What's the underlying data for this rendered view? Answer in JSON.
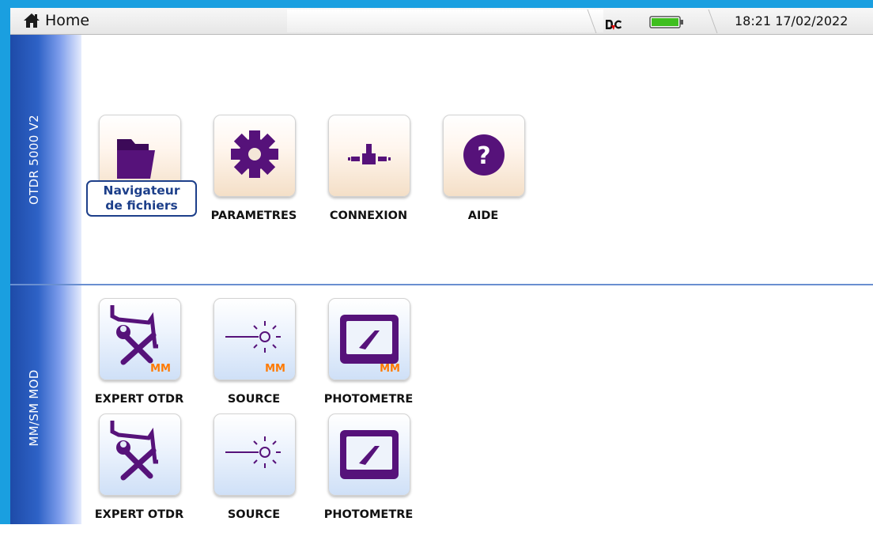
{
  "titlebar": {
    "title": "Home",
    "datetime": "18:21 17/02/2022",
    "battery_level": 1.0
  },
  "groups": [
    {
      "label": "OTDR 5000 V2",
      "tiles": [
        {
          "label": "Navigateur\nde fichiers",
          "icon": "folder-icon",
          "selected": true
        },
        {
          "label": "PARAMETRES",
          "icon": "gear-icon"
        },
        {
          "label": "CONNEXION",
          "icon": "connection-icon"
        },
        {
          "label": "AIDE",
          "icon": "help-icon"
        }
      ]
    },
    {
      "label": "MM/SM MOD",
      "rows": [
        [
          {
            "label": "EXPERT OTDR",
            "icon": "otdr-tools-icon",
            "badge": "MM"
          },
          {
            "label": "SOURCE",
            "icon": "light-source-icon",
            "badge": "MM"
          },
          {
            "label": "PHOTOMETRE",
            "icon": "power-meter-icon",
            "badge": "MM"
          }
        ],
        [
          {
            "label": "EXPERT OTDR",
            "icon": "otdr-tools-icon"
          },
          {
            "label": "SOURCE",
            "icon": "light-source-icon"
          },
          {
            "label": "PHOTOMETRE",
            "icon": "power-meter-icon"
          }
        ]
      ]
    }
  ],
  "colors": {
    "frame": "#1a9fe0",
    "icon_purple": "#56127a",
    "badge_orange": "#ff7a00",
    "selection": "#1d3f8a",
    "side_bar": "#2e62c6"
  }
}
